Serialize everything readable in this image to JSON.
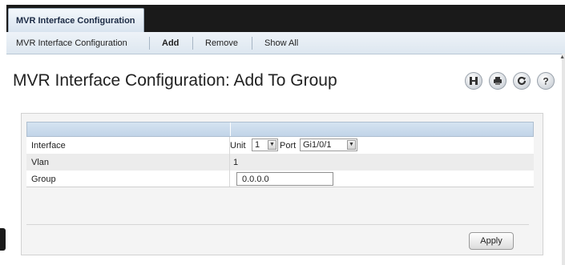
{
  "main_tab": {
    "label": "MVR Interface Configuration"
  },
  "subnav": {
    "items": [
      {
        "label": "MVR Interface Configuration",
        "active": false
      },
      {
        "label": "Add",
        "active": true
      },
      {
        "label": "Remove",
        "active": false
      },
      {
        "label": "Show All",
        "active": false
      }
    ]
  },
  "page_title": "MVR Interface Configuration: Add To Group",
  "toolbar_icons": [
    "save-icon",
    "print-icon",
    "refresh-icon",
    "help-icon"
  ],
  "form": {
    "rows": [
      {
        "label": "Interface",
        "unit_label": "Unit",
        "unit_value": "1",
        "port_label": "Port",
        "port_value": "Gi1/0/1"
      },
      {
        "label": "Vlan",
        "value": "1"
      },
      {
        "label": "Group",
        "value": "0.0.0.0"
      }
    ]
  },
  "apply_label": "Apply",
  "colors": {
    "header_bar": "#1a1a1a",
    "table_header": "#c8d9eb"
  }
}
